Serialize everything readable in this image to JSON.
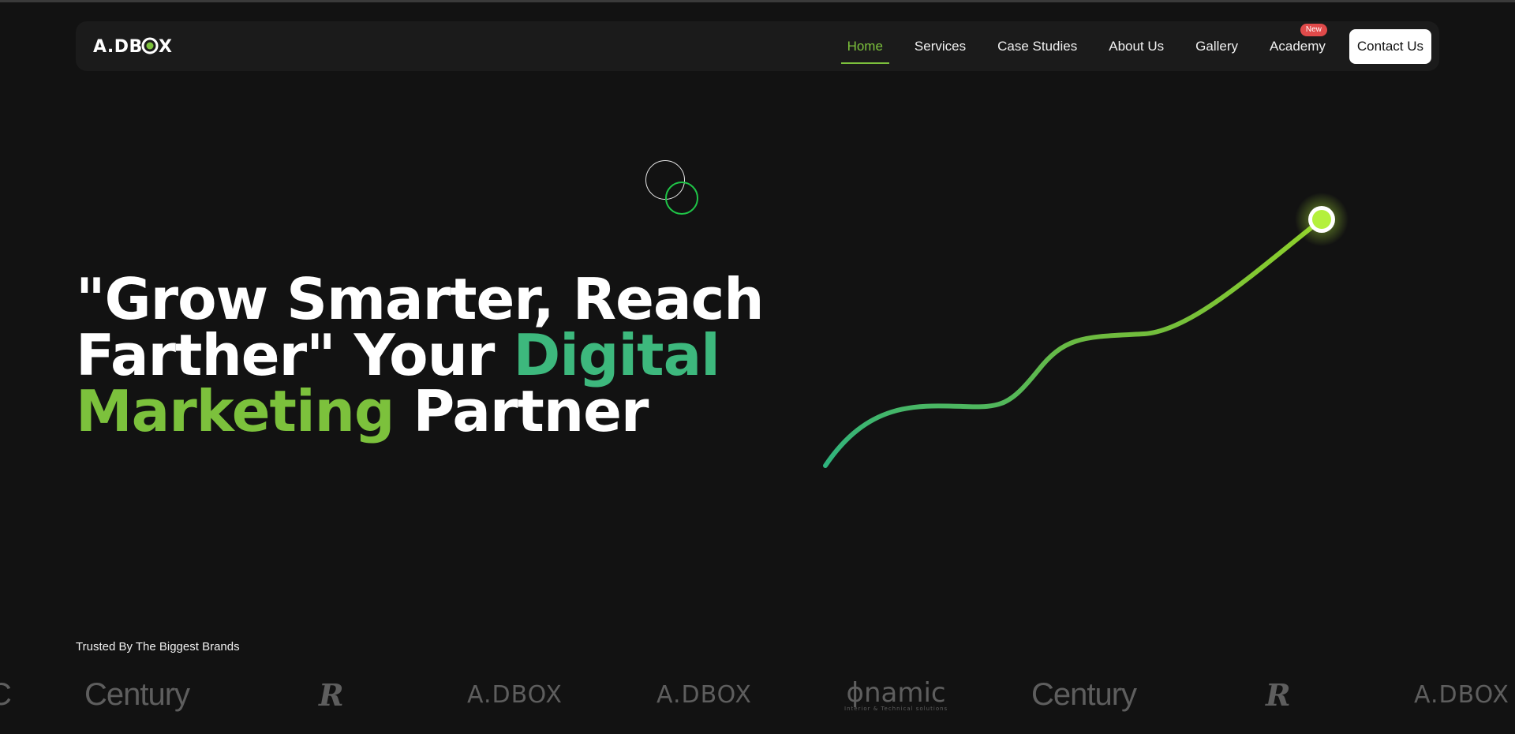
{
  "nav": {
    "logo_text": "A.DBOX",
    "items": [
      {
        "label": "Home",
        "active": true
      },
      {
        "label": "Services"
      },
      {
        "label": "Case Studies"
      },
      {
        "label": "About Us"
      },
      {
        "label": "Gallery"
      },
      {
        "label": "Academy",
        "badge": "New"
      }
    ],
    "contact_label": "Contact Us"
  },
  "hero": {
    "line1": "\"Grow Smarter, Reach",
    "line2_a": "Farther\" Your ",
    "line2_b": "Digital",
    "line3_a": "Marketing",
    "line3_b": " Partner"
  },
  "trusted": {
    "label": "Trusted By The Biggest Brands",
    "brands": [
      {
        "name": "partial-c",
        "text": "C"
      },
      {
        "name": "century",
        "text": "Century"
      },
      {
        "name": "r-logo",
        "text": "R"
      },
      {
        "name": "adbox",
        "text": "A.DBOX"
      },
      {
        "name": "adbox",
        "text": "A.DBOX"
      },
      {
        "name": "namic",
        "text": "ɸnamic",
        "sub": "Interior & Technical solutions"
      },
      {
        "name": "century",
        "text": "Century"
      },
      {
        "name": "r-logo",
        "text": "R"
      },
      {
        "name": "adbox",
        "text": "A.DBOX"
      }
    ]
  },
  "colors": {
    "accent": "#7cc13c",
    "teal": "#3db87d",
    "badge": "#e04a4a",
    "background": "#121212",
    "navbar": "#1b1b1b",
    "cursor_ring_green": "#1fc447",
    "line_end_dot": "#b4f03c"
  },
  "icons": {
    "cursor": "cursor-circle-icon",
    "line_end": "glowing-dot-icon"
  }
}
